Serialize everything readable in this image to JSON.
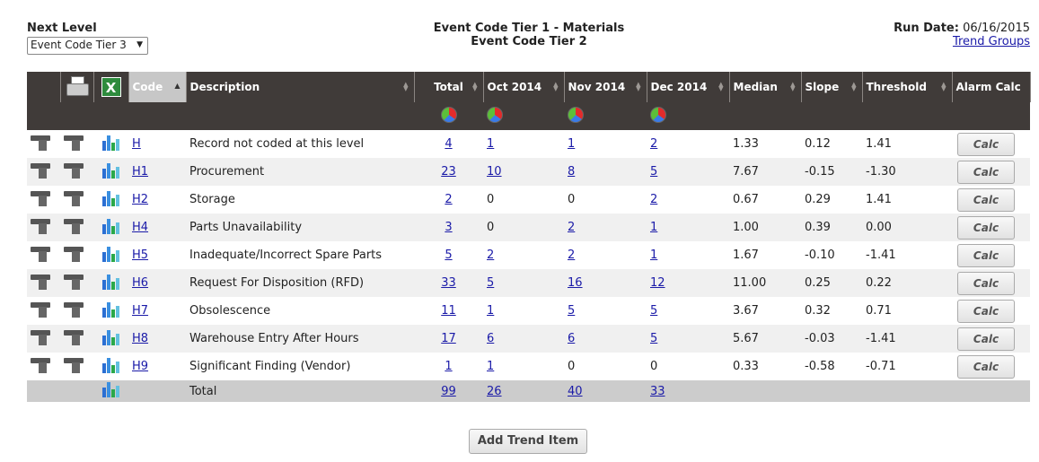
{
  "header": {
    "next_level_label": "Next Level",
    "next_level_value": "Event Code Tier 3",
    "title_line1": "Event Code Tier 1 - Materials",
    "title_line2": "Event Code Tier 2",
    "run_date_label": "Run Date:",
    "run_date_value": "06/16/2015",
    "trend_groups_link": "Trend Groups"
  },
  "columns": {
    "code": "Code",
    "description": "Description",
    "total": "Total",
    "m1": "Oct 2014",
    "m2": "Nov 2014",
    "m3": "Dec 2014",
    "median": "Median",
    "slope": "Slope",
    "threshold": "Threshold",
    "alarm": "Alarm Calc"
  },
  "rows": [
    {
      "code": "H",
      "desc": "Record not coded at this level",
      "total": "4",
      "m1": "1",
      "m2": "1",
      "m3": "2",
      "median": "1.33",
      "slope": "0.12",
      "threshold": "1.41",
      "m1_link": true,
      "m2_link": true,
      "m3_link": true
    },
    {
      "code": "H1",
      "desc": "Procurement",
      "total": "23",
      "m1": "10",
      "m2": "8",
      "m3": "5",
      "median": "7.67",
      "slope": "-0.15",
      "threshold": "-1.30",
      "m1_link": true,
      "m2_link": true,
      "m3_link": true
    },
    {
      "code": "H2",
      "desc": "Storage",
      "total": "2",
      "m1": "0",
      "m2": "0",
      "m3": "2",
      "median": "0.67",
      "slope": "0.29",
      "threshold": "1.41",
      "m1_link": false,
      "m2_link": false,
      "m3_link": true
    },
    {
      "code": "H4",
      "desc": "Parts Unavailability",
      "total": "3",
      "m1": "0",
      "m2": "2",
      "m3": "1",
      "median": "1.00",
      "slope": "0.39",
      "threshold": "0.00",
      "m1_link": false,
      "m2_link": true,
      "m3_link": true
    },
    {
      "code": "H5",
      "desc": "Inadequate/Incorrect Spare Parts",
      "total": "5",
      "m1": "2",
      "m2": "2",
      "m3": "1",
      "median": "1.67",
      "slope": "-0.10",
      "threshold": "-1.41",
      "m1_link": true,
      "m2_link": true,
      "m3_link": true
    },
    {
      "code": "H6",
      "desc": "Request For Disposition (RFD)",
      "total": "33",
      "m1": "5",
      "m2": "16",
      "m3": "12",
      "median": "11.00",
      "slope": "0.25",
      "threshold": "0.22",
      "m1_link": true,
      "m2_link": true,
      "m3_link": true
    },
    {
      "code": "H7",
      "desc": "Obsolescence",
      "total": "11",
      "m1": "1",
      "m2": "5",
      "m3": "5",
      "median": "3.67",
      "slope": "0.32",
      "threshold": "0.71",
      "m1_link": true,
      "m2_link": true,
      "m3_link": true
    },
    {
      "code": "H8",
      "desc": "Warehouse Entry After Hours",
      "total": "17",
      "m1": "6",
      "m2": "6",
      "m3": "5",
      "median": "5.67",
      "slope": "-0.03",
      "threshold": "-1.41",
      "m1_link": true,
      "m2_link": true,
      "m3_link": true
    },
    {
      "code": "H9",
      "desc": "Significant Finding (Vendor)",
      "total": "1",
      "m1": "1",
      "m2": "0",
      "m3": "0",
      "median": "0.33",
      "slope": "-0.58",
      "threshold": "-0.71",
      "m1_link": true,
      "m2_link": false,
      "m3_link": false
    }
  ],
  "calc_label": "Calc",
  "totals": {
    "label": "Total",
    "total": "99",
    "m1": "26",
    "m2": "40",
    "m3": "33"
  },
  "add_trend_label": "Add Trend Item",
  "icons": {
    "print": "printer-icon",
    "excel": "excel-icon",
    "row_tool": "tool-icon",
    "row_chart": "bar-chart-icon",
    "pie": "pie-chart-icon"
  }
}
